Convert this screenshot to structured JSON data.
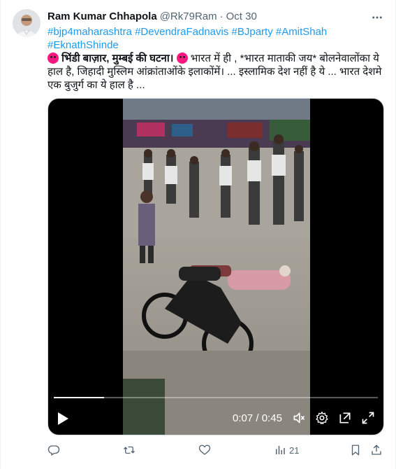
{
  "tweet": {
    "author": {
      "display_name": "Ram Kumar Chhapola",
      "handle": "@Rk79Ram",
      "avatar_icon": "person-avatar"
    },
    "separator": "·",
    "date": "Oct 30",
    "more_icon": "more-horizontal-icon",
    "hashtags_line1": [
      "#bjp4maharashtra",
      "#DevendraFadnavis",
      "#BJparty",
      "#AmitShah"
    ],
    "hashtags_line2": [
      "#EknathShinde"
    ],
    "text_bold": "भिंडी बाज़ार, मुम्बई  की घटना।",
    "text_body": "भारत में ही , *भारत माताकी जय* बोलनेवालोंका ये हाल है, जिहादी मुस्लिम आंक्रांताओंके इलाकोंमें। ... इस्लामिक देश नहीं है ये ... भारत देशमे एक बुजुर्ग का ये हाल है ...",
    "emoji": "angry-face-emoji"
  },
  "video": {
    "current_time": "0:07",
    "duration": "0:45",
    "time_separator": " / ",
    "progress": 0.156,
    "icons": [
      "play-icon",
      "volume-muted-icon",
      "settings-gear-icon",
      "pop-out-icon",
      "fullscreen-icon"
    ]
  },
  "actions": {
    "reply_icon": "reply-icon",
    "retweet_icon": "retweet-icon",
    "like_icon": "like-heart-icon",
    "views_icon": "views-chart-icon",
    "views_count": "21",
    "bookmark_icon": "bookmark-icon",
    "share_icon": "share-icon"
  },
  "colors": {
    "link": "#1d9bf0",
    "secondary_text": "#536471",
    "primary_text": "#0f1419"
  }
}
